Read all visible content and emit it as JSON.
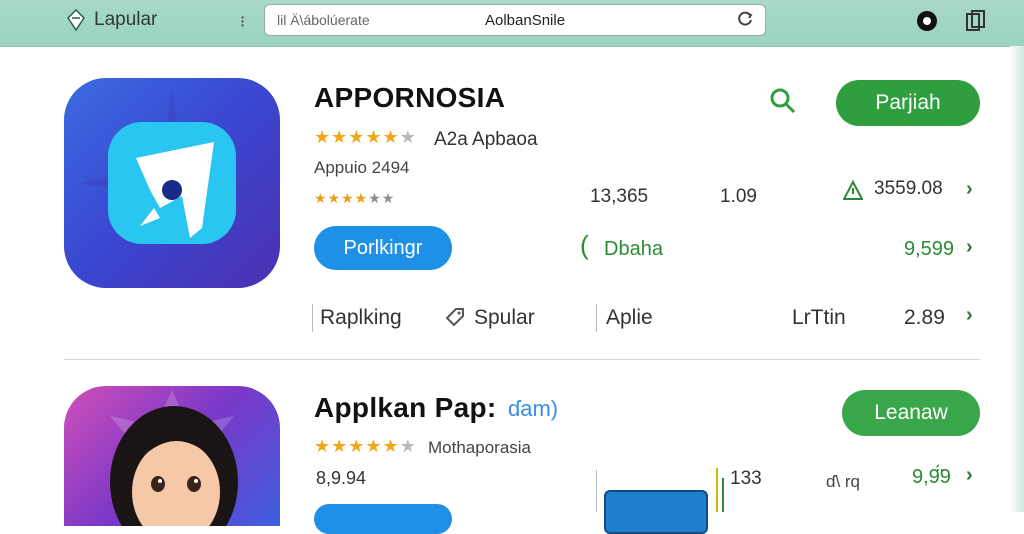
{
  "browser": {
    "tab_title": "Lapular",
    "url_left": "lil Ä\\ábolúerate",
    "url_center": "AolbanSnile"
  },
  "app1": {
    "title": "APPORNOSIA",
    "rating_text": "A2a Apbaoa",
    "subtitle": "Appuio 2494",
    "install_label": "Parjiah",
    "ranking_button": "Porlkingr",
    "stat_a": "13,365",
    "stat_b": "1.09",
    "stat_c": "3559.08",
    "label_d": "Dbaha",
    "price_1": "9,599",
    "row_a": "Raplking",
    "row_b": "Spular",
    "row_c": "Aplie",
    "row_d": "LrTtin",
    "row_e": "2.89"
  },
  "app2": {
    "title": "Applkan Pap:",
    "title_tag": "ɗam)",
    "rating_text": "Mothaporasia",
    "install_label": "Leanaw",
    "stat_a": "8,9.94",
    "stat_b": "133",
    "stat_c": "ɗ\\ rq",
    "price": "9,9̈́9"
  },
  "colors": {
    "accent_green": "#2f9e3e",
    "accent_blue": "#1e90e8",
    "topbar": "#9bd3c2"
  }
}
